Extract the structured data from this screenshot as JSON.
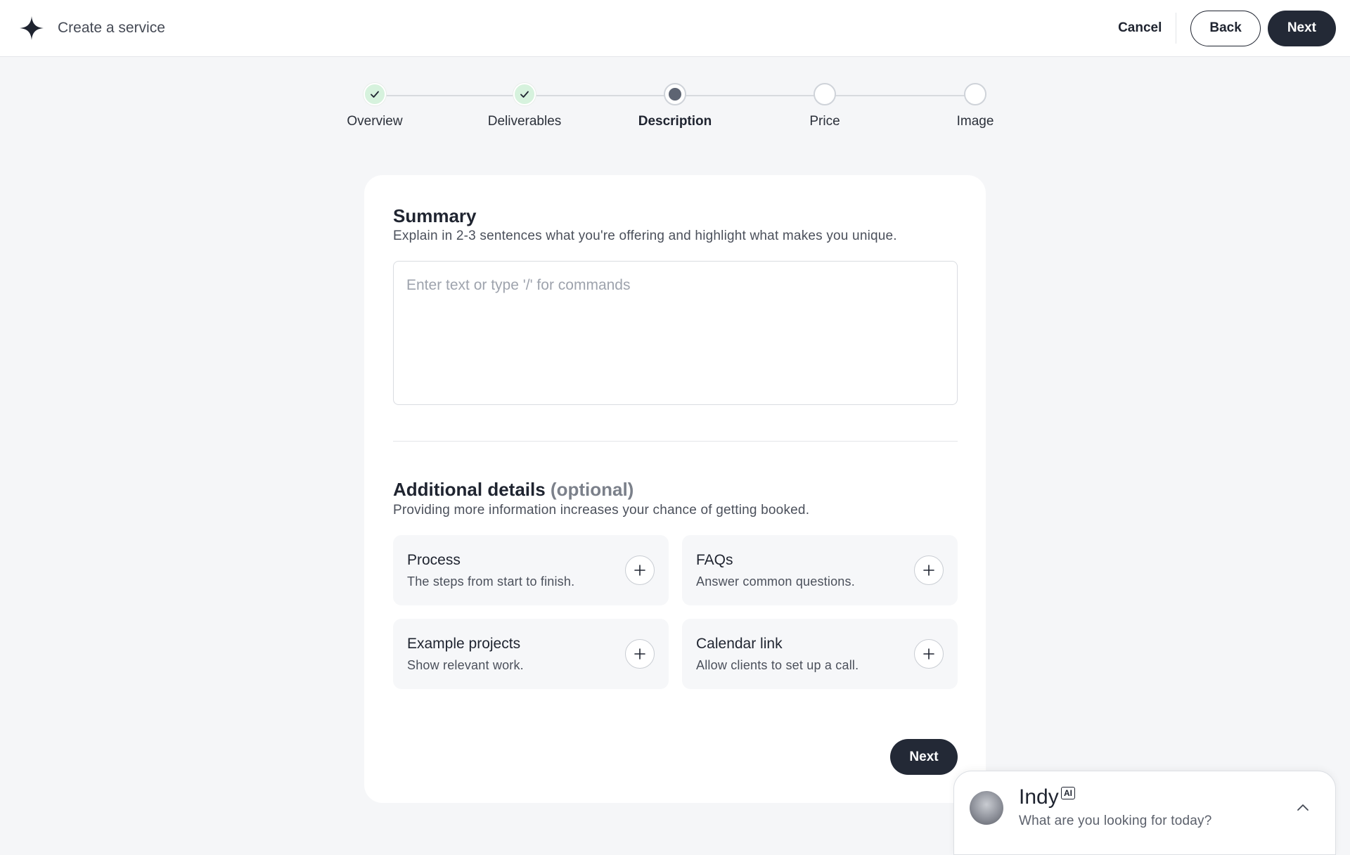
{
  "header": {
    "title": "Create a service",
    "logo_icon": "star-logo-icon",
    "cancel_label": "Cancel",
    "back_label": "Back",
    "next_label": "Next"
  },
  "stepper": {
    "steps": [
      {
        "label": "Overview",
        "status": "complete"
      },
      {
        "label": "Deliverables",
        "status": "complete"
      },
      {
        "label": "Description",
        "status": "current"
      },
      {
        "label": "Price",
        "status": "upcoming"
      },
      {
        "label": "Image",
        "status": "upcoming"
      }
    ]
  },
  "summary": {
    "title": "Summary",
    "description": "Explain in 2-3 sentences what you're offering and highlight what makes you unique.",
    "placeholder": "Enter text or type '/' for commands",
    "value": ""
  },
  "additional": {
    "title": "Additional details",
    "title_suffix": "(optional)",
    "description": "Providing more information increases your chance of getting booked.",
    "options": [
      {
        "title": "Process",
        "description": "The steps from start to finish.",
        "icon": "plus-icon"
      },
      {
        "title": "FAQs",
        "description": "Answer common questions.",
        "icon": "plus-icon"
      },
      {
        "title": "Example projects",
        "description": "Show relevant work.",
        "icon": "plus-icon"
      },
      {
        "title": "Calendar link",
        "description": "Allow clients to set up a call.",
        "icon": "plus-icon"
      }
    ]
  },
  "footer": {
    "next_label": "Next"
  },
  "chat": {
    "name": "Indy",
    "badge": "AI",
    "prompt": "What are you looking for today?",
    "toggle_icon": "chevron-up-icon"
  },
  "colors": {
    "primary_button": "#232936",
    "page_background": "#f5f6f8",
    "step_complete": "#d6f2dd",
    "step_check": "#1f2430"
  }
}
